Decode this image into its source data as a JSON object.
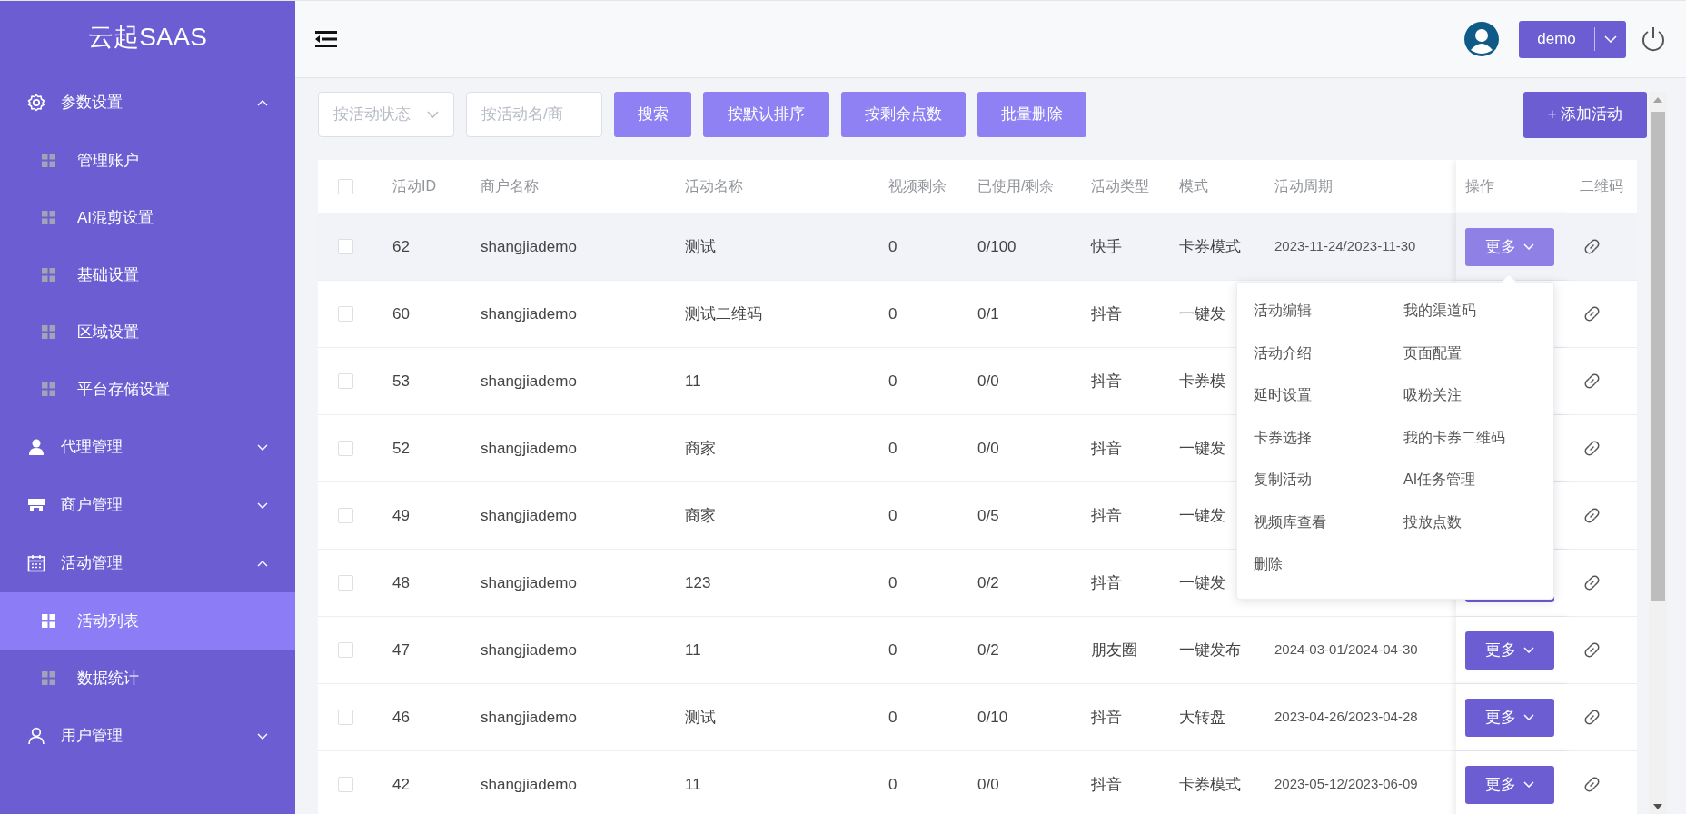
{
  "sidebar": {
    "logo": "云起SAAS",
    "groups": [
      {
        "label": "参数设置",
        "expanded": true,
        "children": [
          {
            "label": "管理账户",
            "selected": false
          },
          {
            "label": "AI混剪设置",
            "selected": false
          },
          {
            "label": "基础设置",
            "selected": false
          },
          {
            "label": "区域设置",
            "selected": false
          },
          {
            "label": "平台存储设置",
            "selected": false
          }
        ]
      },
      {
        "label": "代理管理",
        "expanded": false
      },
      {
        "label": "商户管理",
        "expanded": false
      },
      {
        "label": "活动管理",
        "expanded": true,
        "children": [
          {
            "label": "活动列表",
            "selected": true
          },
          {
            "label": "数据统计",
            "selected": false
          }
        ]
      },
      {
        "label": "用户管理",
        "expanded": false
      }
    ]
  },
  "topbar": {
    "user": "demo"
  },
  "toolbar": {
    "status_select": {
      "placeholder": "按活动状态"
    },
    "search": {
      "placeholder": "按活动名/商"
    },
    "buttons": [
      "搜索",
      "按默认排序",
      "按剩余点数",
      "批量删除"
    ],
    "add_button": "+ 添加活动"
  },
  "table": {
    "select_all": {
      "checked": false
    },
    "columns": [
      "活动ID",
      "商户名称",
      "活动名称",
      "视频剩余",
      "已使用/剩余",
      "活动类型",
      "模式",
      "活动周期",
      "操作",
      "二维码"
    ],
    "rows": [
      {
        "checked": false,
        "hovered": true,
        "cells": [
          "62",
          "shangjiademo",
          "测试",
          "0",
          "0/100",
          "快手",
          "卡券模式",
          "2023-11-24/2023-11-30"
        ],
        "more": "更多"
      },
      {
        "checked": false,
        "hovered": false,
        "cells": [
          "60",
          "shangjiademo",
          "测试二维码",
          "0",
          "0/1",
          "抖音",
          "一键发"
        ]
      },
      {
        "checked": false,
        "hovered": false,
        "cells": [
          "53",
          "shangjiademo",
          "11",
          "0",
          "0/0",
          "抖音",
          "卡券模"
        ]
      },
      {
        "checked": false,
        "hovered": false,
        "cells": [
          "52",
          "shangjiademo",
          "商家",
          "0",
          "0/0",
          "抖音",
          "一键发"
        ]
      },
      {
        "checked": false,
        "hovered": false,
        "cells": [
          "49",
          "shangjiademo",
          "商家",
          "0",
          "0/5",
          "抖音",
          "一键发"
        ]
      },
      {
        "checked": false,
        "hovered": false,
        "cells": [
          "48",
          "shangjiademo",
          "123",
          "0",
          "0/2",
          "抖音",
          "一键发"
        ],
        "more_covered": true
      },
      {
        "checked": false,
        "hovered": false,
        "cells": [
          "47",
          "shangjiademo",
          "11",
          "0",
          "0/2",
          "朋友圈",
          "一键发布",
          "2024-03-01/2024-04-30"
        ],
        "more": "更多"
      },
      {
        "checked": false,
        "hovered": false,
        "cells": [
          "46",
          "shangjiademo",
          "测试",
          "0",
          "0/10",
          "抖音",
          "大转盘",
          "2023-04-26/2023-04-28"
        ],
        "more": "更多"
      },
      {
        "checked": false,
        "hovered": false,
        "cells": [
          "42",
          "shangjiademo",
          "11",
          "0",
          "0/0",
          "抖音",
          "卡券模式",
          "2023-05-12/2023-06-09"
        ],
        "more": "更多"
      }
    ]
  },
  "more_menu": {
    "items": [
      "活动编辑",
      "我的渠道码",
      "活动介绍",
      "页面配置",
      "延时设置",
      "吸粉关注",
      "卡券选择",
      "我的卡券二维码",
      "复制活动",
      "AI任务管理",
      "视频库查看",
      "投放点数",
      "删除"
    ]
  }
}
